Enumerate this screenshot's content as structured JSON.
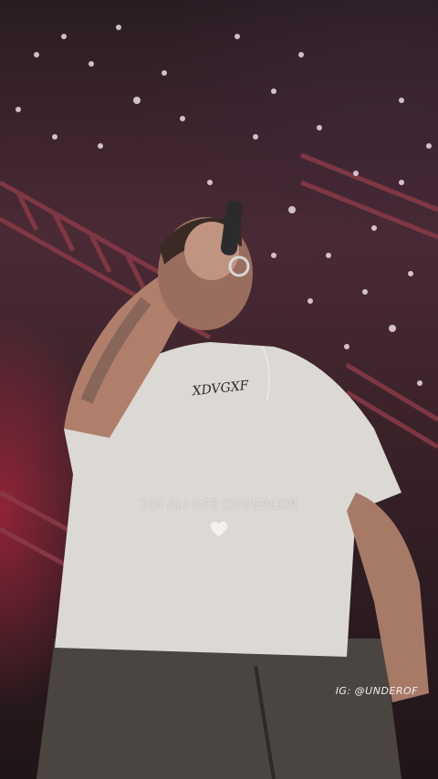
{
  "video": {
    "caption": "TOI ALI OFF COVERCOR",
    "watermark": "IG: @UNDEROF",
    "reaction_icon": "heart-icon"
  },
  "colors": {
    "stage_light": "#dc2846",
    "shirt": "#dcd9d4",
    "caption_text": "#f5f0f0"
  }
}
